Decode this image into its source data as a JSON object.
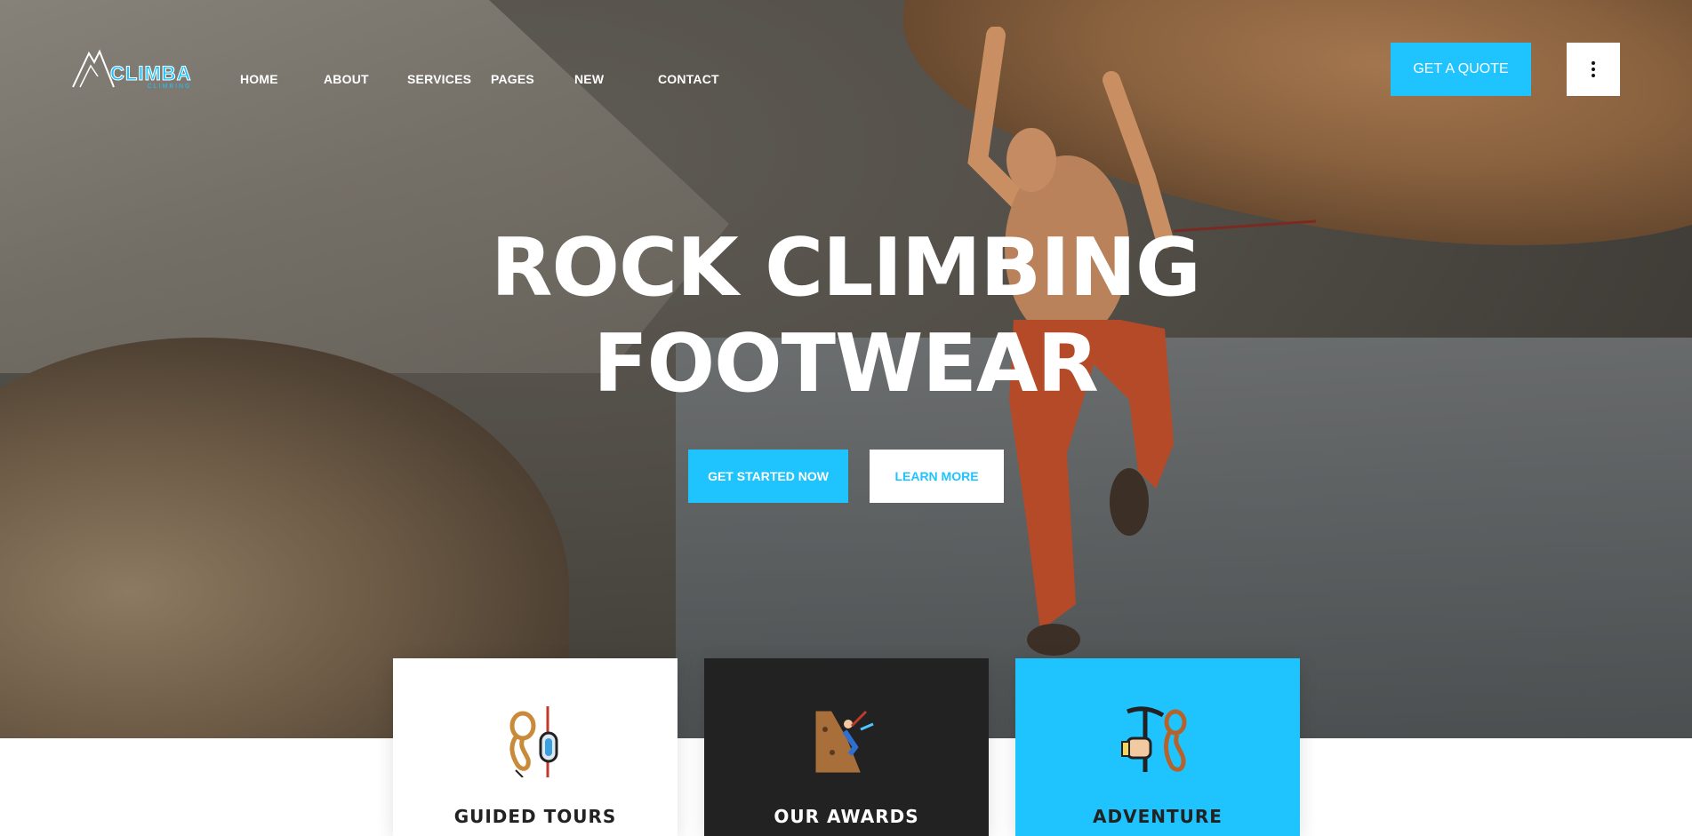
{
  "brand": {
    "name": "CLIMBA",
    "tagline": "CLIMBING"
  },
  "nav": {
    "items": [
      {
        "label": "HOME"
      },
      {
        "label": "ABOUT"
      },
      {
        "label": "SERVICES"
      },
      {
        "label": "PAGES"
      },
      {
        "label": "NEW"
      },
      {
        "label": "CONTACT"
      }
    ],
    "quote_label": "GET A QUOTE",
    "menu_icon": "vertical-dots-icon"
  },
  "hero": {
    "title_line1": "ROCK CLIMBING",
    "title_line2": "FOOTWEAR",
    "primary_cta": "GET STARTED NOW",
    "secondary_cta": "LEARN MORE"
  },
  "features": [
    {
      "title": "GUIDED TOURS",
      "icon": "rope-carabiner-icon"
    },
    {
      "title": "OUR AWARDS",
      "icon": "climber-on-rock-icon"
    },
    {
      "title": "ADVENTURE",
      "icon": "ice-axe-rope-icon"
    }
  ],
  "colors": {
    "accent": "#1fc4ff",
    "dark_card": "#222222",
    "white": "#ffffff"
  }
}
